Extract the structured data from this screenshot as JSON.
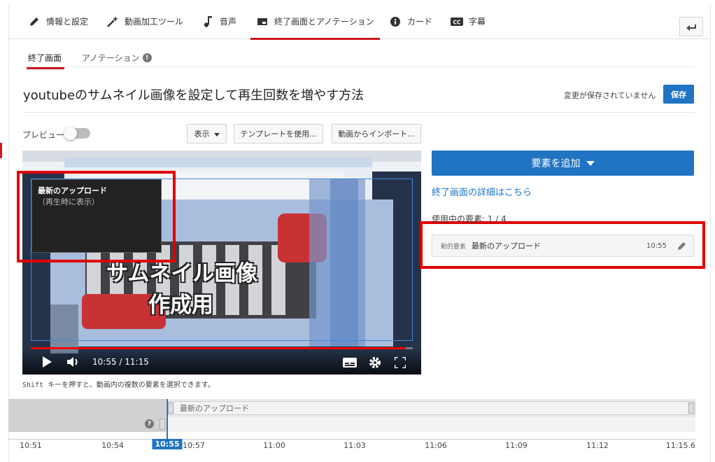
{
  "tabs": [
    {
      "label": "情報と設定",
      "icon": "pencil-icon"
    },
    {
      "label": "動画加工ツール",
      "icon": "magic-wand-icon"
    },
    {
      "label": "音声",
      "icon": "music-note-icon"
    },
    {
      "label": "終了画面とアノテーション",
      "icon": "end-screen-icon",
      "active": true
    },
    {
      "label": "カード",
      "icon": "info-icon"
    },
    {
      "label": "字幕",
      "icon": "cc-icon"
    }
  ],
  "subtabs": {
    "end_screen": "終了画面",
    "annotations": "アノテーション"
  },
  "video_title": "youtubeのサムネイル画像を設定して再生回数を増やす方法",
  "unsaved_text": "変更が保存されていません",
  "save_label": "保存",
  "preview_label": "プレビュー",
  "toolbar": {
    "show": "表示",
    "template": "テンプレートを使用...",
    "import": "動画からインポート..."
  },
  "element_box": {
    "title": "最新のアップロード",
    "subtitle": "（再生時に表示）"
  },
  "player": {
    "time": "10:55 / 11:15",
    "progress": 0.982,
    "thumb_line1": "サムネイル画像",
    "thumb_line2": "作成用"
  },
  "hint": "Shift キーを押すと、動画内の複数の要素を選択できます。",
  "add_element": "要素を追加",
  "details_link": "終了画面の詳細はこちら",
  "usage": "使用中の要素: 1 / 4",
  "element_row": {
    "type": "動的要素",
    "name": "最新のアップロード",
    "time": "10:55"
  },
  "timeline": {
    "track_label": "最新のアップロード",
    "ticks": [
      "10:51",
      "10:54",
      "10:57",
      "11:00",
      "11:03",
      "11:06",
      "11:09",
      "11:12",
      "11:15.6"
    ],
    "current": "10:55"
  },
  "colors": {
    "accent": "#1f74c3",
    "active_tab": "#cc181e",
    "highlight": "#e00000"
  }
}
